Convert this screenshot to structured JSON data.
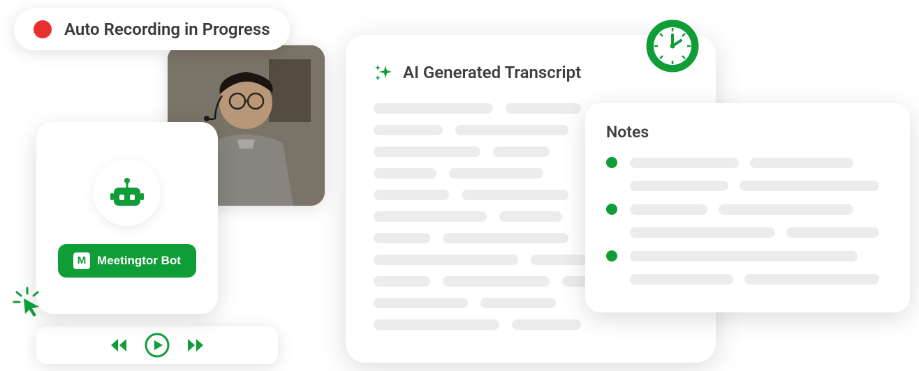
{
  "recording": {
    "status": "Auto Recording in Progress"
  },
  "bot": {
    "button_label": "Meetingtor Bot",
    "logo_letter": "M"
  },
  "transcript": {
    "title": "AI Generated Transcript"
  },
  "notes": {
    "title": "Notes"
  },
  "colors": {
    "brand_green": "#0f9d37",
    "record_red": "#e83030",
    "text_dark": "#3a3a3a"
  }
}
